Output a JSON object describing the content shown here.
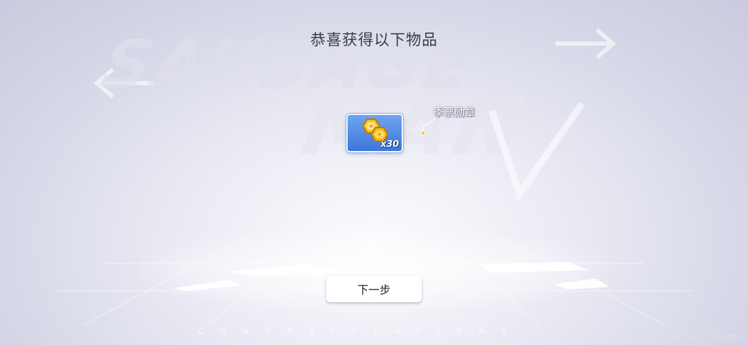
{
  "background": {
    "logo_line1": "SAUSAGE",
    "logo_line2": "MAN"
  },
  "header": {
    "title": "恭喜获得以下物品"
  },
  "reward": {
    "icon": "season-ticket-medal-icon",
    "count": "x30",
    "name": "季票勋章",
    "slot_color": "#4f86e3"
  },
  "footer": {
    "next_label": "下一步",
    "congrats_text": "CONGRATULATIONS",
    "watermark": "1-hw6i5u-21.18.2951212-t.1752251895"
  }
}
